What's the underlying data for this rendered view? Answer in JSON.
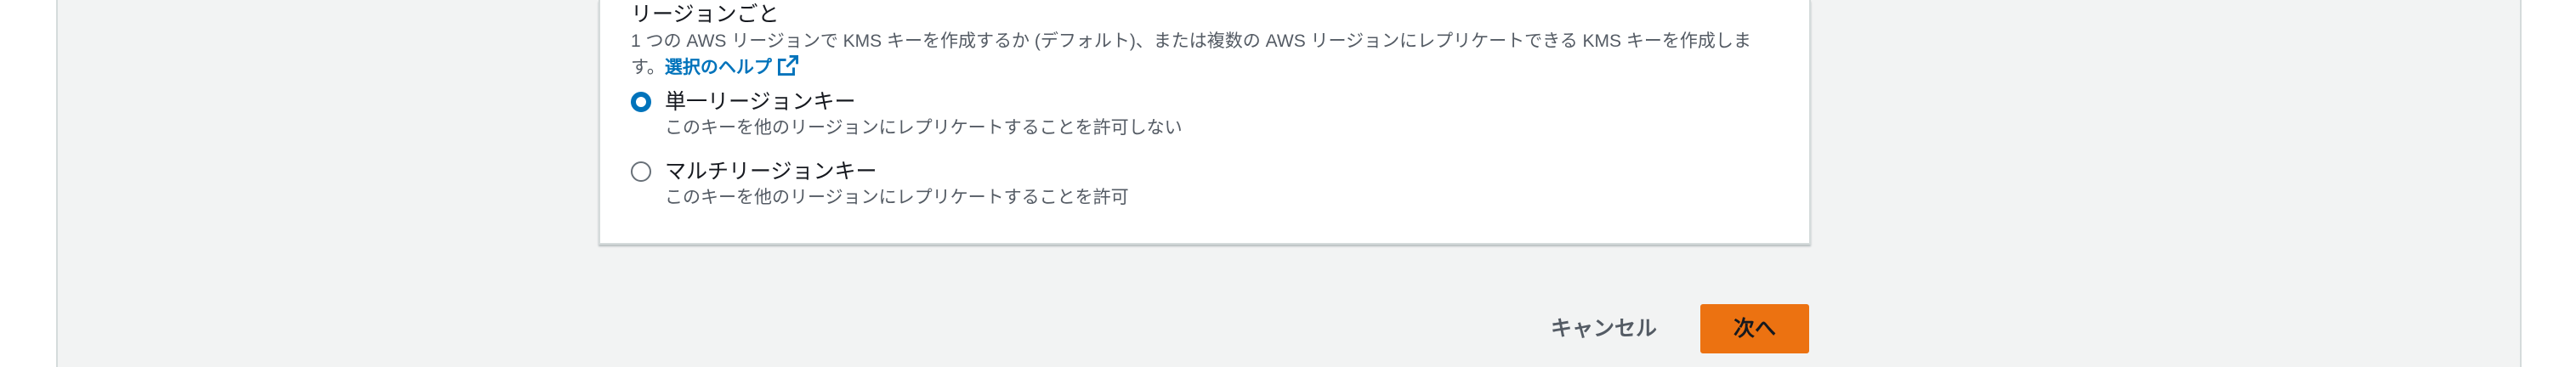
{
  "region_section": {
    "title": "リージョンごと",
    "description": "1 つの AWS リージョンで KMS キーを作成するか (デフォルト)、または複数の AWS リージョンにレプリケートできる KMS キーを作成します。",
    "help_link": "選択のヘルプ",
    "help_icon": "external-link-icon",
    "options": [
      {
        "label": "単一リージョンキー",
        "description": "このキーを他のリージョンにレプリケートすることを許可しない",
        "selected": true
      },
      {
        "label": "マルチリージョンキー",
        "description": "このキーを他のリージョンにレプリケートすることを許可",
        "selected": false
      }
    ]
  },
  "footer": {
    "cancel_label": "キャンセル",
    "next_label": "次へ"
  },
  "colors": {
    "accent": "#0073bb",
    "primary_button": "#ec7211",
    "background": "#f2f3f3"
  }
}
